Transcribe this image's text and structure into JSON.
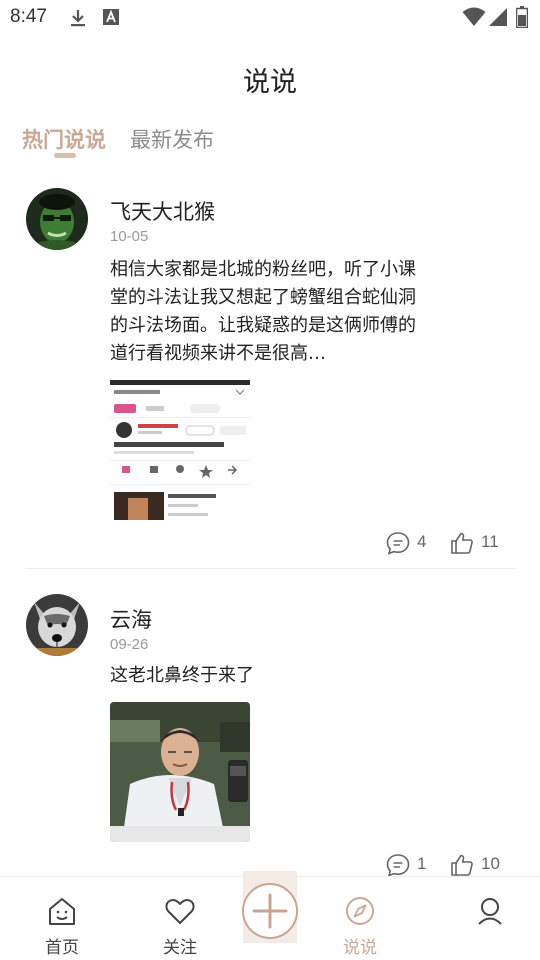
{
  "status_bar": {
    "time": "8:47"
  },
  "page": {
    "title": "说说"
  },
  "tabs": [
    {
      "label": "热门说说",
      "active": true
    },
    {
      "label": "最新发布",
      "active": false
    }
  ],
  "posts": [
    {
      "author": "飞天大北猴",
      "date": "10-05",
      "text": "相信大家都是北城的粉丝吧，听了小课堂的斗法让我又想起了螃蟹组合蛇仙洞的斗法场面。让我疑惑的是这俩师傅的道行看视频来讲不是很高…",
      "comments": "4",
      "likes": "11"
    },
    {
      "author": "云海",
      "date": "09-26",
      "text": "这老北鼻终于来了",
      "comments": "1",
      "likes": "10"
    }
  ],
  "bottom_nav": [
    {
      "label": "首页",
      "icon": "home-icon"
    },
    {
      "label": "关注",
      "icon": "heart-icon"
    },
    {
      "label": "说说",
      "icon": "compass-icon",
      "active": true
    }
  ],
  "colors": {
    "accent": "#c9a996",
    "fab_border": "#c8a491",
    "text_primary": "#222222",
    "text_secondary": "#999999"
  }
}
